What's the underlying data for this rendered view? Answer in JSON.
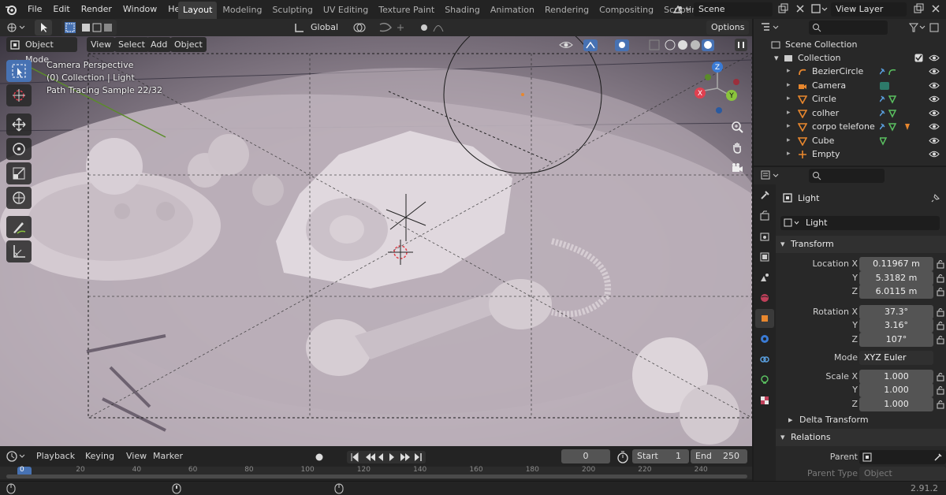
{
  "menu": [
    "File",
    "Edit",
    "Render",
    "Window",
    "Help"
  ],
  "workspaces": [
    {
      "label": "Layout",
      "active": true
    },
    {
      "label": "Modeling"
    },
    {
      "label": "Sculpting"
    },
    {
      "label": "UV Editing"
    },
    {
      "label": "Texture Paint"
    },
    {
      "label": "Shading"
    },
    {
      "label": "Animation"
    },
    {
      "label": "Rendering"
    },
    {
      "label": "Compositing"
    },
    {
      "label": "Scripting"
    }
  ],
  "workspace_add": "+",
  "scene": "Scene",
  "view_layer": "View Layer",
  "toolhead": {
    "orientation": "Global",
    "options": "Options"
  },
  "viewport_header": {
    "mode": "Object Mode",
    "view": "View",
    "select": "Select",
    "add": "Add",
    "object": "Object"
  },
  "overlay": {
    "line1": "Camera Perspective",
    "line2": "(0) Collection | Light",
    "line3": "Path Tracing Sample 22/32"
  },
  "gizmo_axes": {
    "x": "X",
    "y": "Y",
    "z": "Z"
  },
  "timeline": {
    "playback": "Playback",
    "keying": "Keying",
    "view": "View",
    "marker": "Marker",
    "current_frame": "0",
    "start_label": "Start",
    "start": "1",
    "end_label": "End",
    "end": "250",
    "ticks": [
      "0",
      "20",
      "40",
      "60",
      "80",
      "100",
      "120",
      "140",
      "160",
      "180",
      "200",
      "220",
      "240"
    ]
  },
  "version": "2.91.2",
  "outliner": {
    "root": "Scene Collection",
    "collection": "Collection",
    "items": [
      {
        "label": "BezierCircle",
        "icon": "curve-icon"
      },
      {
        "label": "Camera",
        "icon": "camera-icon"
      },
      {
        "label": "Circle",
        "icon": "mesh-icon"
      },
      {
        "label": "colher",
        "icon": "mesh-icon"
      },
      {
        "label": "corpo telefone",
        "icon": "mesh-icon"
      },
      {
        "label": "Cube",
        "icon": "mesh-icon"
      },
      {
        "label": "Empty",
        "icon": "empty-icon"
      }
    ]
  },
  "properties": {
    "object_name": "Light",
    "data_name": "Light",
    "transform_label": "Transform",
    "location_label": "Location X",
    "location": [
      "0.11967 m",
      "5.3182 m",
      "6.0115 m"
    ],
    "rotation_label": "Rotation X",
    "rotation": [
      "37.3°",
      "3.16°",
      "107°"
    ],
    "mode_label": "Mode",
    "mode": "XYZ Euler",
    "scale_label": "Scale X",
    "scale": [
      "1.000",
      "1.000",
      "1.000"
    ],
    "y_label": "Y",
    "z_label": "Z",
    "delta_label": "Delta Transform",
    "relations_label": "Relations",
    "parent_label": "Parent",
    "parent_type_label": "Parent Type",
    "parent_type": "Object"
  },
  "colors": {
    "accent": "#4772b3",
    "axis_x": "#e04050",
    "axis_y": "#8ac43c",
    "axis_z": "#3a7bd5",
    "object_orange": "#e8872e"
  }
}
